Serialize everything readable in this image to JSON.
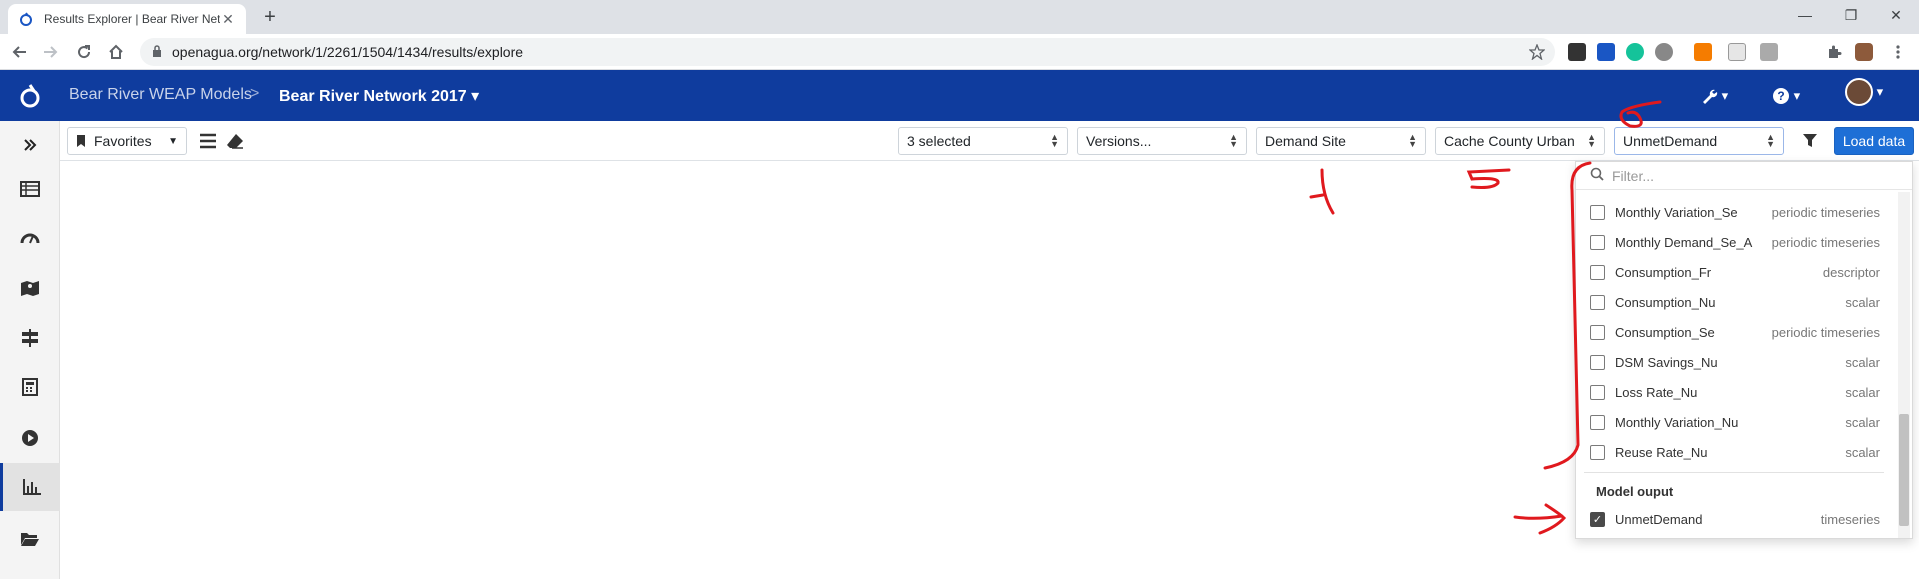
{
  "browser": {
    "tab_title": "Results Explorer | Bear River Netw",
    "url": "openagua.org/network/1/2261/1504/1434/results/explore"
  },
  "header": {
    "crumb_project": "Bear River WEAP Models",
    "crumb_sep": ">",
    "crumb_network": "Bear River Network 2017"
  },
  "toolbar": {
    "favorites": "Favorites",
    "select1": "3 selected",
    "select2": "Versions...",
    "select3": "Demand Site",
    "select4": "Cache County Urban",
    "select5": "UnmetDemand",
    "load": "Load data"
  },
  "dropdown": {
    "filter_placeholder": "Filter...",
    "items": [
      {
        "label": "Monthly Variation_Se",
        "type": "periodic timeseries",
        "checked": false
      },
      {
        "label": "Monthly Demand_Se_A",
        "type": "periodic timeseries",
        "checked": false
      },
      {
        "label": "Consumption_Fr",
        "type": "descriptor",
        "checked": false
      },
      {
        "label": "Consumption_Nu",
        "type": "scalar",
        "checked": false
      },
      {
        "label": "Consumption_Se",
        "type": "periodic timeseries",
        "checked": false
      },
      {
        "label": "DSM Savings_Nu",
        "type": "scalar",
        "checked": false
      },
      {
        "label": "Loss Rate_Nu",
        "type": "scalar",
        "checked": false
      },
      {
        "label": "Monthly Variation_Nu",
        "type": "scalar",
        "checked": false
      },
      {
        "label": "Reuse Rate_Nu",
        "type": "scalar",
        "checked": false
      }
    ],
    "group_label": "Model ouput",
    "group_items": [
      {
        "label": "UnmetDemand",
        "type": "timeseries",
        "checked": true
      }
    ]
  },
  "annotations": {
    "a4": "4",
    "a5": "5",
    "a6": "6",
    "color": "#e0191e"
  },
  "colors": {
    "brand": "#0f3c9e",
    "load_button": "#1e6fd6"
  }
}
